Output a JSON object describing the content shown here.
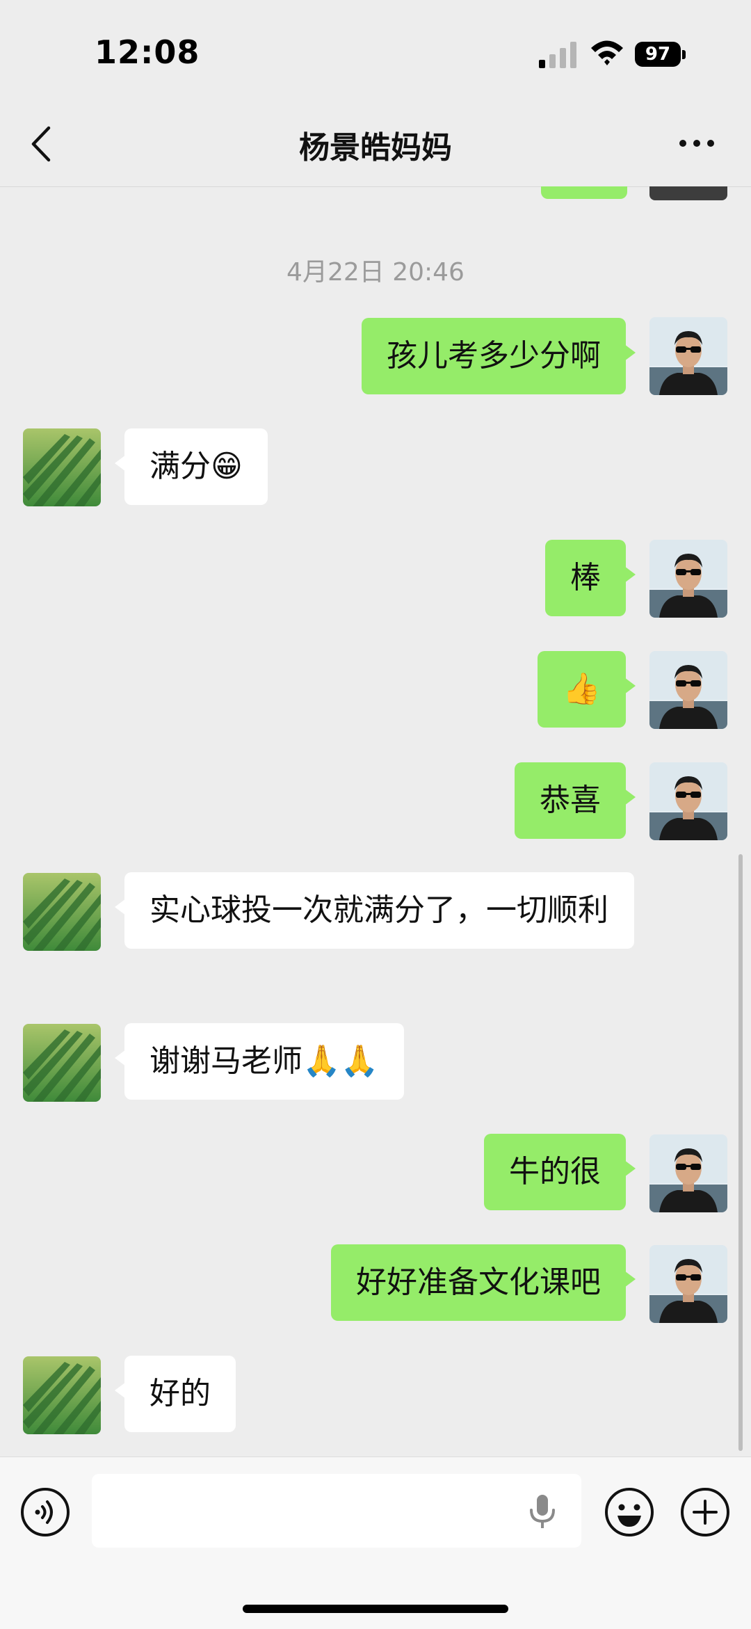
{
  "status": {
    "time": "12:08",
    "battery": "97"
  },
  "nav": {
    "title": "杨景皓妈妈"
  },
  "chat": {
    "timestamp": "4月22日 20:46",
    "messages": [
      {
        "side": "right",
        "text": "孩儿考多少分啊"
      },
      {
        "side": "left",
        "text": "满分😁"
      },
      {
        "side": "right",
        "text": "棒"
      },
      {
        "side": "right",
        "text": "👍"
      },
      {
        "side": "right",
        "text": "恭喜"
      },
      {
        "side": "left",
        "text": "实心球投一次就满分了，一切顺利"
      },
      {
        "side": "left",
        "text": "谢谢马老师🙏🙏"
      },
      {
        "side": "right",
        "text": "牛的很"
      },
      {
        "side": "right",
        "text": "好好准备文化课吧"
      },
      {
        "side": "left",
        "text": "好的"
      }
    ]
  },
  "colors": {
    "outgoing_bubble": "#95ec69",
    "incoming_bubble": "#ffffff",
    "background": "#ededed"
  },
  "icons": {
    "back": "chevron-left-icon",
    "more": "more-dots-icon",
    "voice": "voice-icon",
    "mic": "microphone-icon",
    "emoji": "emoji-icon",
    "plus": "plus-icon"
  }
}
